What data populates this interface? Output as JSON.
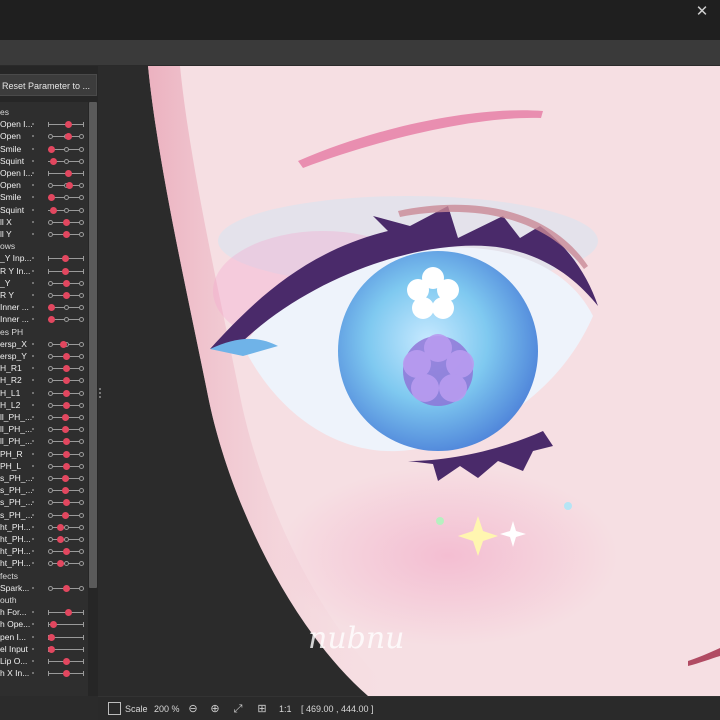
{
  "window": {
    "close_glyph": "✕"
  },
  "panel": {
    "reset_label": "Reset Parameter to ...",
    "rows": [
      {
        "type": "group",
        "label": "es"
      },
      {
        "type": "param",
        "label": "Open I...",
        "kind": "range",
        "value": 0.55
      },
      {
        "type": "param",
        "label": "Open",
        "kind": "ticks3",
        "value": 0.55
      },
      {
        "type": "param",
        "label": "Smile",
        "kind": "ticks2",
        "value": 0.0
      },
      {
        "type": "param",
        "label": "Squint",
        "kind": "ticks2",
        "value": 0.05
      },
      {
        "type": "param",
        "label": "Open I...",
        "kind": "range",
        "value": 0.55
      },
      {
        "type": "param",
        "label": "Open",
        "kind": "ticks3",
        "value": 0.6
      },
      {
        "type": "param",
        "label": "Smile",
        "kind": "ticks2",
        "value": 0.0
      },
      {
        "type": "param",
        "label": "Squint",
        "kind": "ticks2",
        "value": 0.05
      },
      {
        "type": "param",
        "label": "ll X",
        "kind": "ticks3",
        "value": 0.5
      },
      {
        "type": "param",
        "label": "ll Y",
        "kind": "ticks3",
        "value": 0.5
      },
      {
        "type": "group",
        "label": "ows"
      },
      {
        "type": "param",
        "label": "_Y Inp...",
        "kind": "range",
        "value": 0.45
      },
      {
        "type": "param",
        "label": "R Y In...",
        "kind": "range",
        "value": 0.45
      },
      {
        "type": "param",
        "label": "_Y",
        "kind": "ticks3",
        "value": 0.5
      },
      {
        "type": "param",
        "label": "R Y",
        "kind": "ticks3",
        "value": 0.5
      },
      {
        "type": "param",
        "label": "Inner ...",
        "kind": "ticks2",
        "value": 0.0
      },
      {
        "type": "param",
        "label": "Inner ...",
        "kind": "ticks2",
        "value": 0.0
      },
      {
        "type": "group",
        "label": "es PH"
      },
      {
        "type": "param",
        "label": "ersp_X",
        "kind": "ticks3",
        "value": 0.4
      },
      {
        "type": "param",
        "label": "ersp_Y",
        "kind": "ticks3",
        "value": 0.5
      },
      {
        "type": "param",
        "label": "H_R1",
        "kind": "ticks3",
        "value": 0.5
      },
      {
        "type": "param",
        "label": "H_R2",
        "kind": "ticks3",
        "value": 0.5
      },
      {
        "type": "param",
        "label": "H_L1",
        "kind": "ticks3",
        "value": 0.5
      },
      {
        "type": "param",
        "label": "H_L2",
        "kind": "ticks3",
        "value": 0.5
      },
      {
        "type": "param",
        "label": "ll_PH_...",
        "kind": "ticks3",
        "value": 0.45
      },
      {
        "type": "param",
        "label": "ll_PH_...",
        "kind": "ticks3",
        "value": 0.45
      },
      {
        "type": "param",
        "label": "ll_PH_...",
        "kind": "ticks3",
        "value": 0.5
      },
      {
        "type": "param",
        "label": "PH_R",
        "kind": "ticks3",
        "value": 0.5
      },
      {
        "type": "param",
        "label": "PH_L",
        "kind": "ticks3",
        "value": 0.5
      },
      {
        "type": "param",
        "label": "s_PH_...",
        "kind": "ticks3",
        "value": 0.45
      },
      {
        "type": "param",
        "label": "s_PH_...",
        "kind": "ticks3",
        "value": 0.45
      },
      {
        "type": "param",
        "label": "s_PH_...",
        "kind": "ticks3",
        "value": 0.5
      },
      {
        "type": "param",
        "label": "s_PH_...",
        "kind": "ticks3",
        "value": 0.45
      },
      {
        "type": "param",
        "label": "ht_PH...",
        "kind": "ticks3",
        "value": 0.3
      },
      {
        "type": "param",
        "label": "ht_PH...",
        "kind": "ticks3",
        "value": 0.3
      },
      {
        "type": "param",
        "label": "ht_PH...",
        "kind": "ticks3",
        "value": 0.5
      },
      {
        "type": "param",
        "label": "ht_PH...",
        "kind": "ticks3",
        "value": 0.3
      },
      {
        "type": "group",
        "label": "fects"
      },
      {
        "type": "param",
        "label": "Spark...",
        "kind": "ticks3",
        "value": 0.5
      },
      {
        "type": "group",
        "label": "outh"
      },
      {
        "type": "param",
        "label": "h For...",
        "kind": "range",
        "value": 0.55
      },
      {
        "type": "param",
        "label": "h Ope...",
        "kind": "range",
        "value": 0.05
      },
      {
        "type": "param",
        "label": "pen I...",
        "kind": "range",
        "value": 0.0
      },
      {
        "type": "param",
        "label": "el Input",
        "kind": "range",
        "value": 0.0
      },
      {
        "type": "param",
        "label": "Lip O...",
        "kind": "range",
        "value": 0.5
      },
      {
        "type": "param",
        "label": "h X In...",
        "kind": "range",
        "value": 0.5
      }
    ]
  },
  "canvas": {
    "watermark": "nubnu"
  },
  "statusbar": {
    "scale_label": "Scale",
    "zoom_value": "200 %",
    "zoom_out_glyph": "⊖",
    "zoom_in_glyph": "⊕",
    "fit_glyph": "⤢",
    "center_glyph": "⊞",
    "actual_size_label": "1:1",
    "coords": "[ 469.00 , 444.00 ]"
  },
  "colors": {
    "accent": "#e2475f",
    "panel_bg": "#2e2e2e",
    "skin": "#f6dfe3",
    "iris": "#7fc9f0"
  }
}
